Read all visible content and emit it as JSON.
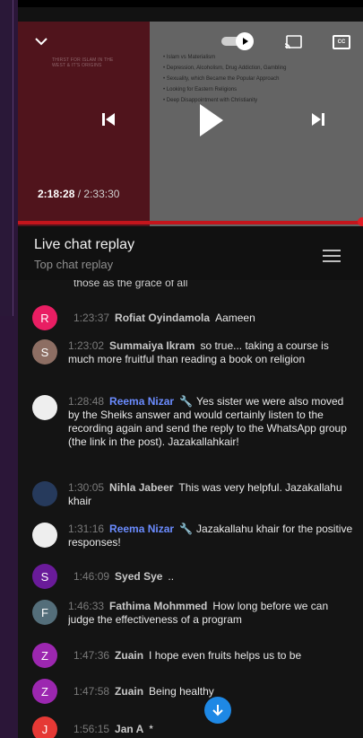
{
  "player": {
    "slide_left_text": "THIRST FOR ISLAM IN THE WEST & IT'S ORIGINS",
    "slide_items": [
      "Islam vs Materialism",
      "Depression, Alcoholism, Drug Addiction, Gambling",
      "Sexuality, which Became the Popular Approach",
      "Looking for Eastern Religions",
      "Deep Disappointment with Christianity"
    ],
    "current_time": "2:18:28",
    "separator": "/",
    "duration": "2:33:30",
    "progress_fraction": 0.9,
    "cc_label": "CC"
  },
  "chat": {
    "title": "Live chat replay",
    "subtitle": "Top chat replay",
    "partial_text": "those as the grace of all",
    "messages": [
      {
        "avatar_letter": "R",
        "avatar_color": "#e91e63",
        "time": "1:23:37",
        "author": "Rofiat Oyindamola",
        "text": "Aameen"
      },
      {
        "avatar_letter": "S",
        "avatar_color": "#8d6e63",
        "time": "1:23:02",
        "author": "Summaiya Ikram",
        "text": "so true... taking a course is much more fruitful than reading a book on religion"
      },
      {
        "avatar_letter": "",
        "avatar_color": "#eeeeee",
        "time": "1:28:48",
        "author": "Reema Nizar",
        "moderator": true,
        "text": "Yes sister we were also moved by the Sheiks answer and would certainly listen to the recording again and send the reply to the WhatsApp group (the link in the post). Jazakallahkair!"
      },
      {
        "avatar_letter": "",
        "avatar_color": "#263a5c",
        "time": "1:30:05",
        "author": "Nihla Jabeer",
        "text": "This was very helpful. Jazakallahu khair"
      },
      {
        "avatar_letter": "",
        "avatar_color": "#eeeeee",
        "time": "1:31:16",
        "author": "Reema Nizar",
        "moderator": true,
        "text": "Jazakallahu khair for the positive responses!"
      },
      {
        "avatar_letter": "S",
        "avatar_color": "#6a1b9a",
        "time": "1:46:09",
        "author": "Syed Sye",
        "text": ".."
      },
      {
        "avatar_letter": "F",
        "avatar_color": "#546e7a",
        "time": "1:46:33",
        "author": "Fathima Mohmmed",
        "text": "How long before we can judge the effectiveness of a program"
      },
      {
        "avatar_letter": "Z",
        "avatar_color": "#9c27b0",
        "time": "1:47:36",
        "author": "Zuain",
        "text": "I hope even fruits helps us to be"
      },
      {
        "avatar_letter": "Z",
        "avatar_color": "#9c27b0",
        "time": "1:47:58",
        "author": "Zuain",
        "text": "Being healthy"
      },
      {
        "avatar_letter": "J",
        "avatar_color": "#e53935",
        "time": "1:56:15",
        "author": "Jan A",
        "text": "*"
      }
    ]
  },
  "icons": {
    "collapse": "chevron-down-icon",
    "autoplay": "autoplay-toggle-icon",
    "cast": "cast-icon",
    "captions": "cc-icon",
    "previous": "skip-previous-icon",
    "play": "play-icon",
    "next": "skip-next-icon",
    "filter": "tune-icon",
    "scroll_down": "arrow-down-icon",
    "moderator": "wrench-icon"
  }
}
